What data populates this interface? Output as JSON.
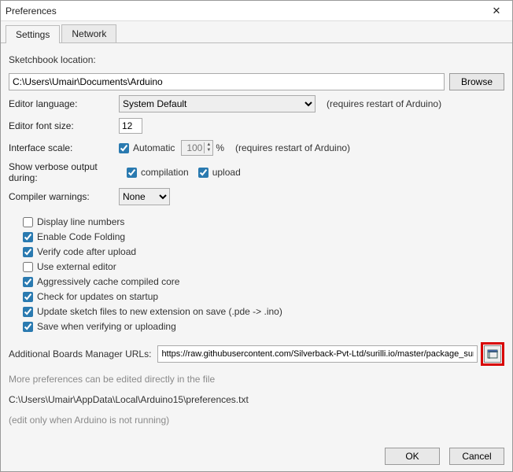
{
  "window": {
    "title": "Preferences"
  },
  "tabs": {
    "settings": "Settings",
    "network": "Network"
  },
  "sketchbook": {
    "label": "Sketchbook location:",
    "path": "C:\\Users\\Umair\\Documents\\Arduino",
    "browse": "Browse"
  },
  "editor_language": {
    "label": "Editor language:",
    "value": "System Default",
    "hint": "(requires restart of Arduino)"
  },
  "editor_font": {
    "label": "Editor font size:",
    "value": "12"
  },
  "interface_scale": {
    "label": "Interface scale:",
    "automatic": "Automatic",
    "value": "100",
    "percent": "%",
    "hint": "(requires restart of Arduino)"
  },
  "verbose": {
    "label": "Show verbose output during:",
    "compilation": "compilation",
    "upload": "upload"
  },
  "compiler_warnings": {
    "label": "Compiler warnings:",
    "value": "None"
  },
  "checks": {
    "display_line_numbers": "Display line numbers",
    "enable_code_folding": "Enable Code Folding",
    "verify_after_upload": "Verify code after upload",
    "use_external_editor": "Use external editor",
    "cache_core": "Aggressively cache compiled core",
    "check_updates": "Check for updates on startup",
    "update_sketch_ext": "Update sketch files to new extension on save (.pde -> .ino)",
    "save_on_verify": "Save when verifying or uploading"
  },
  "boards_urls": {
    "label": "Additional Boards Manager URLs:",
    "value": "https://raw.githubusercontent.com/Silverback-Pvt-Ltd/surilli.io/master/package_surilli.io_index.json"
  },
  "more_prefs": {
    "line1": "More preferences can be edited directly in the file",
    "path": "C:\\Users\\Umair\\AppData\\Local\\Arduino15\\preferences.txt",
    "line2": "(edit only when Arduino is not running)"
  },
  "buttons": {
    "ok": "OK",
    "cancel": "Cancel"
  }
}
